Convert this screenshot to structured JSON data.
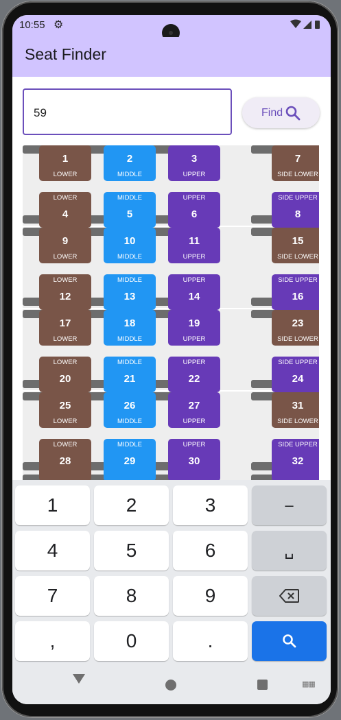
{
  "status": {
    "time": "10:55",
    "icons_text": "▾◢▮"
  },
  "app": {
    "title": "Seat Finder"
  },
  "search": {
    "value": "59",
    "find_label": "Find"
  },
  "seats": {
    "r0": [
      {
        "num": "1",
        "type": "LOWER",
        "cls": "lower"
      },
      {
        "num": "2",
        "type": "MIDDLE",
        "cls": "middle"
      },
      {
        "num": "3",
        "type": "UPPER",
        "cls": "upper"
      },
      {
        "num": "7",
        "type": "SIDE LOWER",
        "cls": "lower"
      }
    ],
    "r1": [
      {
        "num": "4",
        "type": "LOWER",
        "cls": "lower"
      },
      {
        "num": "5",
        "type": "MIDDLE",
        "cls": "middle"
      },
      {
        "num": "6",
        "type": "UPPER",
        "cls": "upper"
      },
      {
        "num": "8",
        "type": "SIDE UPPER",
        "cls": "upper"
      }
    ],
    "r2": [
      {
        "num": "9",
        "type": "LOWER",
        "cls": "lower"
      },
      {
        "num": "10",
        "type": "MIDDLE",
        "cls": "middle"
      },
      {
        "num": "11",
        "type": "UPPER",
        "cls": "upper"
      },
      {
        "num": "15",
        "type": "SIDE LOWER",
        "cls": "lower"
      }
    ],
    "r3": [
      {
        "num": "12",
        "type": "LOWER",
        "cls": "lower"
      },
      {
        "num": "13",
        "type": "MIDDLE",
        "cls": "middle"
      },
      {
        "num": "14",
        "type": "UPPER",
        "cls": "upper"
      },
      {
        "num": "16",
        "type": "SIDE UPPER",
        "cls": "upper"
      }
    ],
    "r4": [
      {
        "num": "17",
        "type": "LOWER",
        "cls": "lower"
      },
      {
        "num": "18",
        "type": "MIDDLE",
        "cls": "middle"
      },
      {
        "num": "19",
        "type": "UPPER",
        "cls": "upper"
      },
      {
        "num": "23",
        "type": "SIDE LOWER",
        "cls": "lower"
      }
    ],
    "r5": [
      {
        "num": "20",
        "type": "LOWER",
        "cls": "lower"
      },
      {
        "num": "21",
        "type": "MIDDLE",
        "cls": "middle"
      },
      {
        "num": "22",
        "type": "UPPER",
        "cls": "upper"
      },
      {
        "num": "24",
        "type": "SIDE UPPER",
        "cls": "upper"
      }
    ],
    "r6": [
      {
        "num": "25",
        "type": "LOWER",
        "cls": "lower"
      },
      {
        "num": "26",
        "type": "MIDDLE",
        "cls": "middle"
      },
      {
        "num": "27",
        "type": "UPPER",
        "cls": "upper"
      },
      {
        "num": "31",
        "type": "SIDE LOWER",
        "cls": "lower"
      }
    ],
    "r7": [
      {
        "num": "28",
        "type": "LOWER",
        "cls": "lower"
      },
      {
        "num": "29",
        "type": "MIDDLE",
        "cls": "middle"
      },
      {
        "num": "30",
        "type": "UPPER",
        "cls": "upper"
      },
      {
        "num": "32",
        "type": "SIDE UPPER",
        "cls": "upper"
      }
    ]
  },
  "keyboard": {
    "rows": [
      [
        "1",
        "2",
        "3",
        "–"
      ],
      [
        "4",
        "5",
        "6",
        "␣"
      ],
      [
        "7",
        "8",
        "9",
        "⌫"
      ],
      [
        ",",
        "0",
        ".",
        "search"
      ]
    ]
  },
  "colors": {
    "lower": "#795548",
    "middle": "#2196f3",
    "upper": "#673ab7",
    "accent": "#6b4fbb",
    "appbar": "#d1c4ff"
  }
}
